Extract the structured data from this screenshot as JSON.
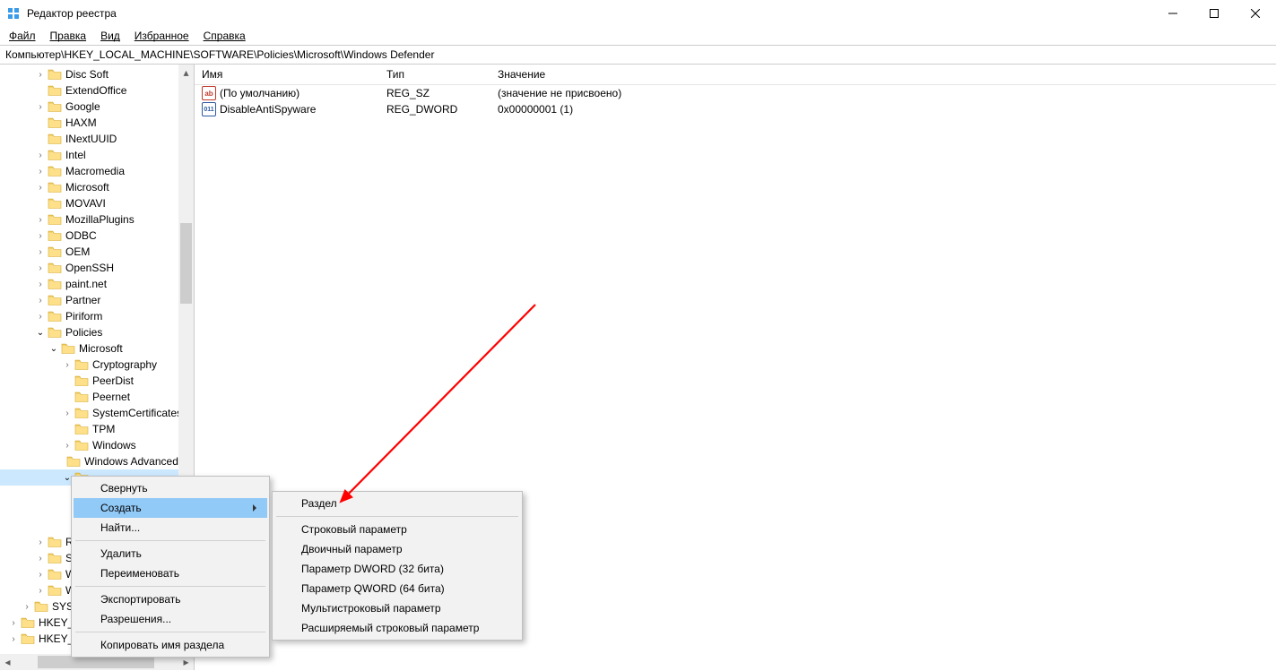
{
  "window": {
    "title": "Редактор реестра"
  },
  "menu": {
    "file": "Файл",
    "edit": "Правка",
    "view": "Вид",
    "favorites": "Избранное",
    "help": "Справка"
  },
  "address": "Компьютер\\HKEY_LOCAL_MACHINE\\SOFTWARE\\Policies\\Microsoft\\Windows Defender",
  "list": {
    "cols": {
      "name": "Имя",
      "type": "Тип",
      "data": "Значение"
    },
    "rows": [
      {
        "icon": "sz",
        "name": "(По умолчанию)",
        "type": "REG_SZ",
        "data": "(значение не присвоено)"
      },
      {
        "icon": "bin",
        "name": "DisableAntiSpyware",
        "type": "REG_DWORD",
        "data": "0x00000001 (1)"
      }
    ]
  },
  "tree": [
    {
      "i": 1,
      "a": ">",
      "l": "Disc Soft"
    },
    {
      "i": 1,
      "a": "",
      "l": "ExtendOffice"
    },
    {
      "i": 1,
      "a": ">",
      "l": "Google"
    },
    {
      "i": 1,
      "a": "",
      "l": "HAXM"
    },
    {
      "i": 1,
      "a": "",
      "l": "INextUUID"
    },
    {
      "i": 1,
      "a": ">",
      "l": "Intel"
    },
    {
      "i": 1,
      "a": ">",
      "l": "Macromedia"
    },
    {
      "i": 1,
      "a": ">",
      "l": "Microsoft"
    },
    {
      "i": 1,
      "a": "",
      "l": "MOVAVI"
    },
    {
      "i": 1,
      "a": ">",
      "l": "MozillaPlugins"
    },
    {
      "i": 1,
      "a": ">",
      "l": "ODBC"
    },
    {
      "i": 1,
      "a": ">",
      "l": "OEM"
    },
    {
      "i": 1,
      "a": ">",
      "l": "OpenSSH"
    },
    {
      "i": 1,
      "a": ">",
      "l": "paint.net"
    },
    {
      "i": 1,
      "a": ">",
      "l": "Partner"
    },
    {
      "i": 1,
      "a": ">",
      "l": "Piriform"
    },
    {
      "i": 1,
      "a": "v",
      "l": "Policies"
    },
    {
      "i": 2,
      "a": "v",
      "l": "Microsoft"
    },
    {
      "i": 3,
      "a": ">",
      "l": "Cryptography"
    },
    {
      "i": 3,
      "a": "",
      "l": "PeerDist"
    },
    {
      "i": 3,
      "a": "",
      "l": "Peernet"
    },
    {
      "i": 3,
      "a": ">",
      "l": "SystemCertificates"
    },
    {
      "i": 3,
      "a": "",
      "l": "TPM"
    },
    {
      "i": 3,
      "a": ">",
      "l": "Windows"
    },
    {
      "i": 3,
      "a": "",
      "l": "Windows Advanced Th"
    },
    {
      "i": 3,
      "a": "v",
      "l": "",
      "selected": true
    },
    {
      "i": 4,
      "a": "",
      "l": ""
    },
    {
      "i": 4,
      "a": "",
      "l": ""
    },
    {
      "i": 4,
      "a": "",
      "l": ""
    },
    {
      "i": 1,
      "a": ">",
      "l": "Regist"
    },
    {
      "i": 1,
      "a": ">",
      "l": "SyncIn"
    },
    {
      "i": 1,
      "a": ">",
      "l": "Windo"
    },
    {
      "i": 1,
      "a": ">",
      "l": "WOW"
    },
    {
      "i": 0,
      "a": ">",
      "l": "SYSTEM"
    },
    {
      "i": -1,
      "a": ">",
      "l": "HKEY_USERS"
    },
    {
      "i": -1,
      "a": ">",
      "l": "HKEY_CURR"
    }
  ],
  "ctx1": {
    "collapse": "Свернуть",
    "create": "Создать",
    "find": "Найти...",
    "delete": "Удалить",
    "rename": "Переименовать",
    "export": "Экспортировать",
    "perms": "Разрешения...",
    "copyname": "Копировать имя раздела"
  },
  "ctx2": {
    "key": "Раздел",
    "string": "Строковый параметр",
    "binary": "Двоичный параметр",
    "dword": "Параметр DWORD (32 бита)",
    "qword": "Параметр QWORD (64 бита)",
    "multi": "Мультистроковый параметр",
    "expandable": "Расширяемый строковый параметр"
  }
}
